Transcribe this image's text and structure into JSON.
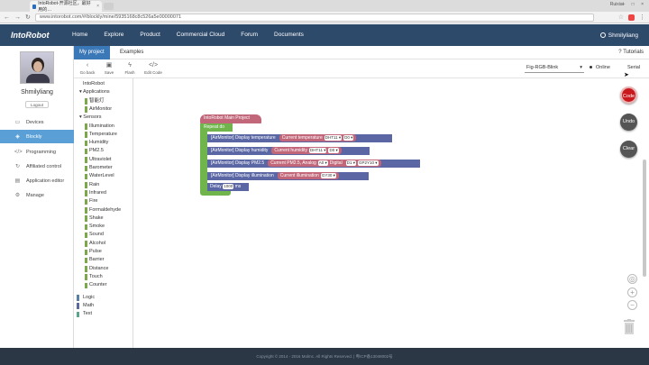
{
  "browser": {
    "tab_title": "IntoRobot-开源社区，最好用的…",
    "tab_close": "×",
    "window_user": "Ruixiat",
    "window_controls": "– □ ×",
    "url": "www.intorobot.com/#/blockly/mine/5935168c8c526a5e00000071"
  },
  "app": {
    "logo": "IntoRobot",
    "nav": [
      "Home",
      "Explore",
      "Product",
      "Commercial Cloud",
      "Forum",
      "Documents"
    ],
    "account": "Shmilyliang"
  },
  "sidebar": {
    "username": "Shmilyliang",
    "logout": "Logout",
    "items": [
      {
        "label": "Devices",
        "icon": "devices-icon",
        "glyph": "▭"
      },
      {
        "label": "Blockly",
        "icon": "blockly-icon",
        "glyph": "◈",
        "active": true
      },
      {
        "label": "Programming",
        "icon": "code-icon",
        "glyph": "</>"
      },
      {
        "label": "Affiliated control",
        "icon": "control-icon",
        "glyph": "↻"
      },
      {
        "label": "Application editor",
        "icon": "editor-icon",
        "glyph": "▤"
      },
      {
        "label": "Manage",
        "icon": "manage-icon",
        "glyph": "⚙"
      }
    ]
  },
  "tabs": {
    "my_project": "My project",
    "examples": "Examples",
    "tutorials": "Tutorials",
    "tutorials_glyph": "?"
  },
  "toolbar": {
    "buttons": [
      {
        "label": "Go back",
        "glyph": "‹"
      },
      {
        "label": "Save",
        "glyph": "▣"
      },
      {
        "label": "Flash",
        "glyph": "ϟ"
      },
      {
        "label": "Edit Code",
        "glyph": "</>"
      }
    ],
    "board": "Fig-RGB-Blink",
    "board_caret": "▾",
    "online": "Online",
    "serial": "Serial"
  },
  "categories": [
    {
      "label": "IntoRobot",
      "color": "",
      "indent": 0
    },
    {
      "label": "▾ Applications",
      "color": "",
      "indent": 1
    },
    {
      "label": "智能灯",
      "color": "#7aa84a",
      "indent": 2
    },
    {
      "label": "AirMonitor",
      "color": "#7aa84a",
      "indent": 2
    },
    {
      "label": "▾ Sensors",
      "color": "",
      "indent": 1
    },
    {
      "label": "Illumination",
      "color": "#7aa84a",
      "indent": 2
    },
    {
      "label": "Temperature",
      "color": "#7aa84a",
      "indent": 2
    },
    {
      "label": "Humidity",
      "color": "#7aa84a",
      "indent": 2
    },
    {
      "label": "PM2.5",
      "color": "#7aa84a",
      "indent": 2
    },
    {
      "label": "Ultraviolet",
      "color": "#7aa84a",
      "indent": 2
    },
    {
      "label": "Barometer",
      "color": "#7aa84a",
      "indent": 2
    },
    {
      "label": "WaterLevel",
      "color": "#7aa84a",
      "indent": 2
    },
    {
      "label": "Rain",
      "color": "#7aa84a",
      "indent": 2
    },
    {
      "label": "Infrared",
      "color": "#7aa84a",
      "indent": 2
    },
    {
      "label": "Fire",
      "color": "#7aa84a",
      "indent": 2
    },
    {
      "label": "Formaldehyde",
      "color": "#7aa84a",
      "indent": 2
    },
    {
      "label": "Shake",
      "color": "#7aa84a",
      "indent": 2
    },
    {
      "label": "Smoke",
      "color": "#7aa84a",
      "indent": 2
    },
    {
      "label": "Sound",
      "color": "#7aa84a",
      "indent": 2
    },
    {
      "label": "Alcohol",
      "color": "#7aa84a",
      "indent": 2
    },
    {
      "label": "Pulse",
      "color": "#7aa84a",
      "indent": 2
    },
    {
      "label": "Barrier",
      "color": "#7aa84a",
      "indent": 2
    },
    {
      "label": "Distance",
      "color": "#7aa84a",
      "indent": 2
    },
    {
      "label": "Touch",
      "color": "#7aa84a",
      "indent": 2
    },
    {
      "label": "Counter",
      "color": "#7aa84a",
      "indent": 2
    },
    {
      "label": "Logic",
      "color": "#5b80a5",
      "indent": 0,
      "gap": true
    },
    {
      "label": "Math",
      "color": "#5b67a5",
      "indent": 0
    },
    {
      "label": "Text",
      "color": "#5ba58c",
      "indent": 0
    }
  ],
  "blocks": {
    "main": "IntoRobot Main Project",
    "repeat": "Repeat do",
    "rows": [
      {
        "label": "[AirMonitor] Display temperature",
        "param": "Current temperature",
        "opts": [
          "DHT11 ▾",
          "D0 ▾"
        ]
      },
      {
        "label": "[AirMonitor] Display humidity",
        "param": "Current humidity",
        "opts": [
          "DHT11 ▾",
          "D0 ▾"
        ]
      },
      {
        "label": "[AirMonitor] Display PM2.5",
        "param": "Current PM2.5,  Analog",
        "opts": [
          "A0 ▾",
          "Digital",
          "D1 ▾",
          "GP2Y10 ▾"
        ]
      },
      {
        "label": "[AirMonitor] Display illumination",
        "param": "Current illumination",
        "opts": [
          "GY30 ▾"
        ]
      }
    ],
    "delay_label": "Delay",
    "delay_value": "1000",
    "delay_unit": "ms"
  },
  "workspace_buttons": {
    "code": "Code",
    "undo": "Undo",
    "clear": "Clear",
    "zoom_in": "+",
    "zoom_out": "−",
    "recenter": "◎"
  },
  "colors": {
    "code": "#c9191e",
    "undo": "#555555",
    "clear": "#555555",
    "main_block": "#c2677a",
    "loop": "#6fb54c",
    "sensor_block": "#5b67a5"
  },
  "footer": "Copyright © 2014 - 2016 Molmc. All Rights Reserved.   |   粤ICP备13048002号"
}
